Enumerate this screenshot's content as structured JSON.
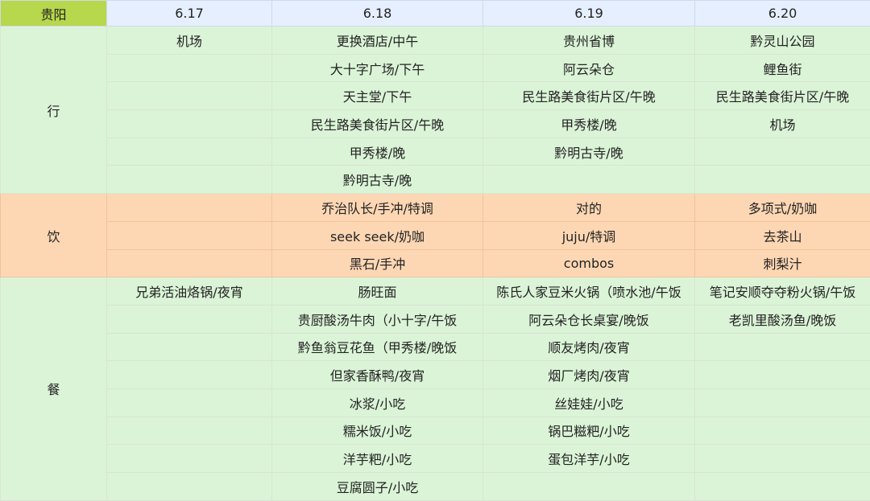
{
  "header": {
    "corner": "贵阳",
    "dates": [
      "6.17",
      "6.18",
      "6.19",
      "6.20"
    ]
  },
  "groups": {
    "xing": {
      "label": "行",
      "rows": [
        [
          "机场",
          "更换酒店/中午",
          "贵州省博",
          "黔灵山公园"
        ],
        [
          "",
          "大十字广场/下午",
          "阿云朵仓",
          "鲤鱼街"
        ],
        [
          "",
          "天主堂/下午",
          "民生路美食街片区/午晚",
          "民生路美食街片区/午晚"
        ],
        [
          "",
          "民生路美食街片区/午晚",
          "甲秀楼/晚",
          "机场"
        ],
        [
          "",
          "甲秀楼/晚",
          "黔明古寺/晚",
          ""
        ],
        [
          "",
          "黔明古寺/晚",
          "",
          ""
        ]
      ]
    },
    "yin": {
      "label": "饮",
      "rows": [
        [
          "",
          "乔治队长/手冲/特调",
          "对的",
          "多项式/奶咖"
        ],
        [
          "",
          "seek seek/奶咖",
          "juju/特调",
          "去茶山"
        ],
        [
          "",
          "黑石/手冲",
          "combos",
          "刺梨汁"
        ]
      ]
    },
    "can": {
      "label": "餐",
      "rows": [
        [
          "兄弟活油烙锅/夜宵",
          "肠旺面",
          "陈氏人家豆米火锅（喷水池/午饭",
          "笔记安顺夺夺粉火锅/午饭"
        ],
        [
          "",
          "贵厨酸汤牛肉（小十字/午饭",
          "阿云朵仓长桌宴/晚饭",
          "老凯里酸汤鱼/晚饭"
        ],
        [
          "",
          "黔鱼翁豆花鱼（甲秀楼/晚饭",
          "顺友烤肉/夜宵",
          ""
        ],
        [
          "",
          "但家香酥鸭/夜宵",
          "烟厂烤肉/夜宵",
          ""
        ],
        [
          "",
          "冰浆/小吃",
          "丝娃娃/小吃",
          ""
        ],
        [
          "",
          "糯米饭/小吃",
          "锅巴糍粑/小吃",
          ""
        ],
        [
          "",
          "洋芋粑/小吃",
          "蛋包洋芋/小吃",
          ""
        ],
        [
          "",
          "豆腐圆子/小吃",
          "",
          ""
        ]
      ]
    }
  }
}
